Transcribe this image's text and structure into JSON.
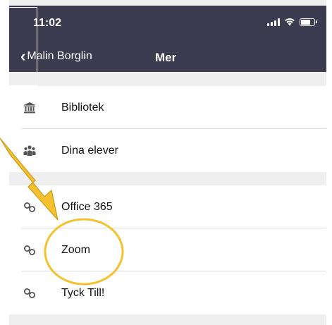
{
  "status": {
    "time": "11:02"
  },
  "nav": {
    "back_label": "Malin Borglin",
    "title": "Mer"
  },
  "groups": [
    {
      "items": [
        {
          "label": "Bibliotek",
          "icon": "library-icon"
        },
        {
          "label": "Dina elever",
          "icon": "students-icon"
        }
      ]
    },
    {
      "items": [
        {
          "label": "Office 365",
          "icon": "link-icon"
        },
        {
          "label": "Zoom",
          "icon": "link-icon"
        },
        {
          "label": "Tyck Till!",
          "icon": "link-icon"
        }
      ]
    }
  ],
  "annotation": {
    "arrow_color": "#f5c12e",
    "circle_color": "#f5c12e"
  },
  "colors": {
    "header": "#3d3b4f",
    "background": "#efefef"
  }
}
